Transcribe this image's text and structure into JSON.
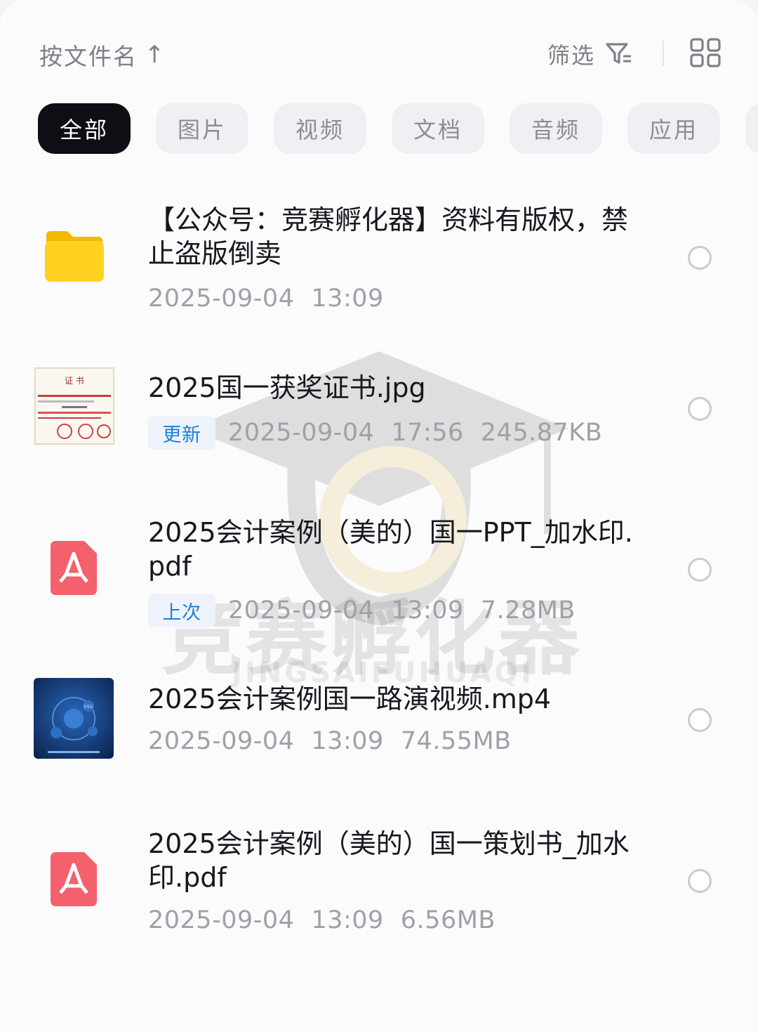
{
  "toolbar": {
    "sort_label": "按文件名",
    "sort_arrow": "↑",
    "filter_label": "筛选"
  },
  "tabs": [
    "全部",
    "图片",
    "视频",
    "文档",
    "音频",
    "应用"
  ],
  "active_tab": "全部",
  "files": [
    {
      "name": "【公众号：竞赛孵化器】资料有版权，禁止盗版倒卖",
      "type": "folder",
      "date": "2025-09-04",
      "time": "13:09",
      "size": "",
      "badge": ""
    },
    {
      "name": "2025国一获奖证书.jpg",
      "type": "image",
      "date": "2025-09-04",
      "time": "17:56",
      "size": "245.87KB",
      "badge": "更新",
      "thumb_heading": "证 书"
    },
    {
      "name": "2025会计案例（美的）国一PPT_加水印.pdf",
      "type": "pdf",
      "date": "2025-09-04",
      "time": "13:09",
      "size": "7.28MB",
      "badge": "上次"
    },
    {
      "name": "2025会计案例国一路演视频.mp4",
      "type": "video",
      "date": "2025-09-04",
      "time": "13:09",
      "size": "74.55MB",
      "badge": "",
      "thumb_label": "ESG"
    },
    {
      "name": "2025会计案例（美的）国一策划书_加水印.pdf",
      "type": "pdf",
      "date": "2025-09-04",
      "time": "13:09",
      "size": "6.56MB",
      "badge": ""
    }
  ],
  "watermark": {
    "text": "竞赛孵化器",
    "subtext": "JINGSAIFUHUAQI"
  },
  "colors": {
    "active_tab_bg": "#0d0f14",
    "badge_text": "#1e7fd8",
    "folder": "#ffd21f",
    "pdf": "#f4606c"
  }
}
